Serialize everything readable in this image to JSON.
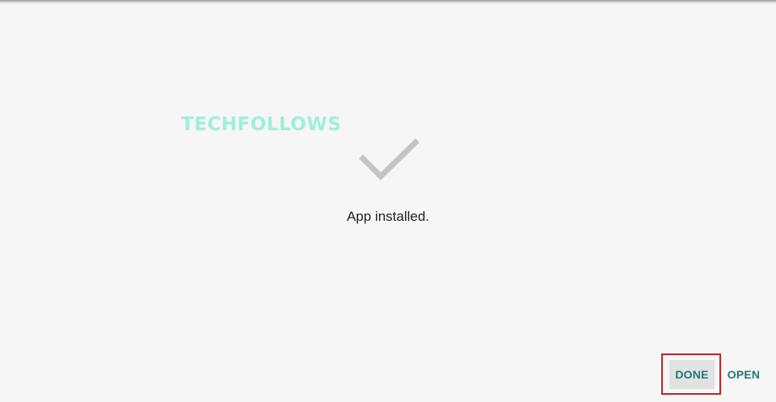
{
  "watermark": {
    "text": "TECHFOLLOWS"
  },
  "status": {
    "icon": "checkmark-icon",
    "message": "App installed."
  },
  "actions": {
    "done_label": "DONE",
    "open_label": "OPEN"
  },
  "colors": {
    "background": "#f6f6f6",
    "accent": "#1e7a75",
    "check": "#c4c4c4",
    "highlight": "#b8252b",
    "watermark": "#8ff0d4"
  }
}
